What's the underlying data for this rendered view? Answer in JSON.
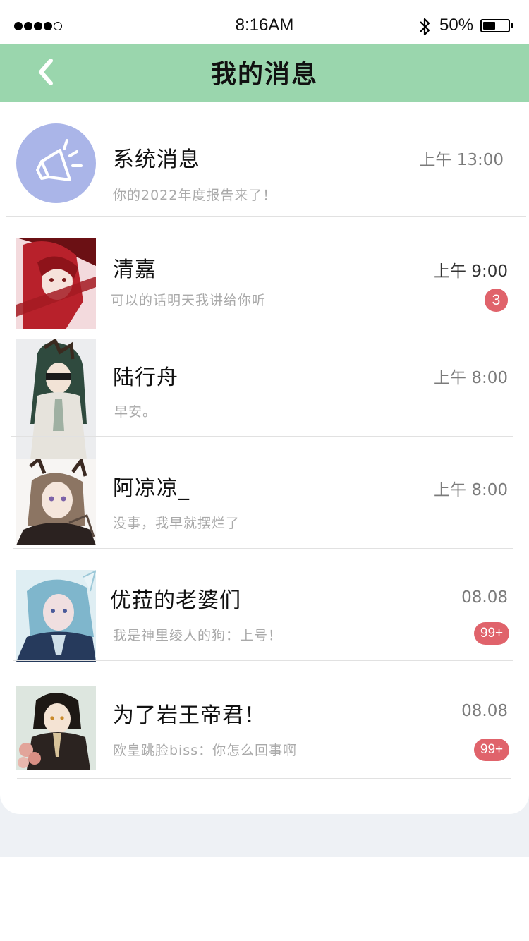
{
  "status_bar": {
    "time": "8:16AM",
    "battery": "50%",
    "battery_level": 0.5
  },
  "header": {
    "title": "我的消息"
  },
  "conversations": [
    {
      "name": "系统消息",
      "preview": "你的2022年度报告来了！",
      "time": "上午 13:00",
      "badge": ""
    },
    {
      "name": "清嘉",
      "preview": "可以的话明天我讲给你听",
      "time": "上午 9:00",
      "badge": "3"
    },
    {
      "name": "陆行舟",
      "preview": "早安。",
      "time": "上午 8:00",
      "badge": ""
    },
    {
      "name": "阿凉凉_",
      "preview": "没事，我早就摆烂了",
      "time": "上午 8:00",
      "badge": ""
    },
    {
      "name": "优菈的老婆们",
      "preview": "我是神里绫人的狗：上号！",
      "time": "08.08",
      "badge": "99+"
    },
    {
      "name": "为了岩王帝君！",
      "preview": "欧皇跳脸biss：你怎么回事啊",
      "time": "08.08",
      "badge": "99+"
    }
  ],
  "colors": {
    "header_bg": "#9ad6ad",
    "badge_bg": "#e0636b",
    "system_avatar_bg": "#aab5e8"
  }
}
